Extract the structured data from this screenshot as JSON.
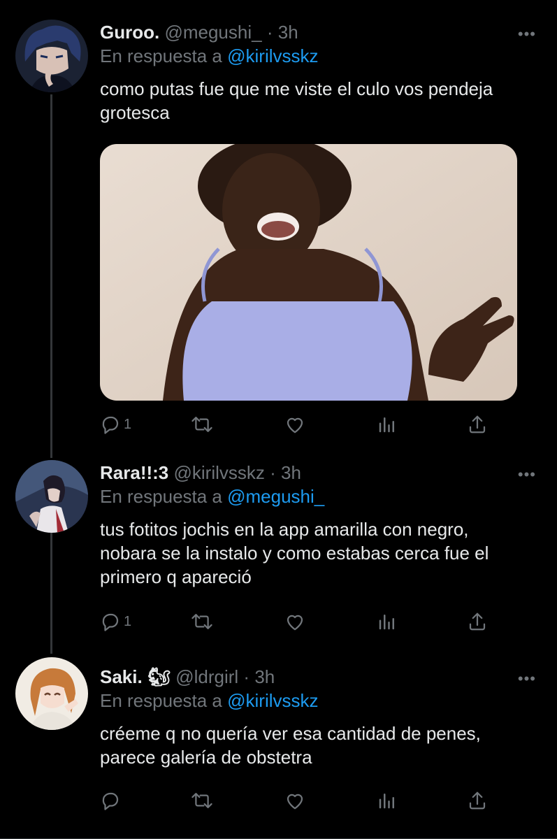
{
  "reply_prefix": "En respuesta a",
  "tweets": [
    {
      "name": "Guroo.",
      "emoji": "",
      "handle": "@megushi_",
      "dot": "·",
      "time": "3h",
      "reply_to": "@kirilvsskz",
      "text": "como putas fue que me viste el culo vos pendeja grotesca",
      "has_media": true,
      "replies": "1",
      "more": "•••"
    },
    {
      "name": "Rara!!:3",
      "emoji": "",
      "handle": "@kirilvsskz",
      "dot": "·",
      "time": "3h",
      "reply_to": "@megushi_",
      "text": "tus fotitos jochis en la app amarilla con negro, nobara se la instalo y como estabas cerca fue el primero q apareció",
      "has_media": false,
      "replies": "1",
      "more": "•••"
    },
    {
      "name": "Saki.",
      "emoji": "🐿",
      "handle": "@ldrgirl",
      "dot": "·",
      "time": "3h",
      "reply_to": "@kirilvsskz",
      "text": "créeme q no quería ver esa cantidad de penes, parece galería de obstetra",
      "has_media": false,
      "replies": "",
      "more": "•••"
    }
  ],
  "colors": {
    "background": "#000000",
    "text": "#e7e9ea",
    "secondary": "#71767b",
    "link": "#1d9bf0",
    "thread_line": "#333639"
  },
  "icons": [
    "reply-icon",
    "retweet-icon",
    "like-icon",
    "analytics-icon",
    "share-icon",
    "more-icon"
  ]
}
